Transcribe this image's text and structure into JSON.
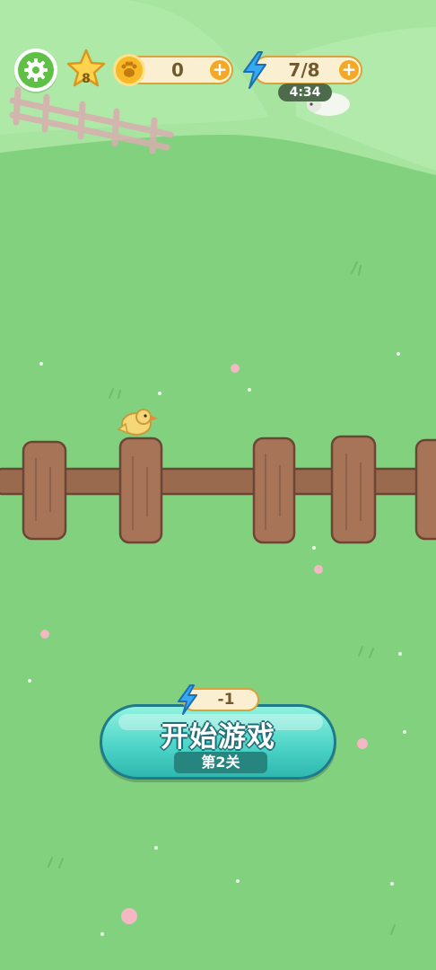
{
  "hud": {
    "star_level": "8",
    "coins": "0",
    "energy": "7/8",
    "energy_timer": "4:34"
  },
  "start": {
    "cost": "-1",
    "button_label": "开始游戏",
    "level_label": "第2关"
  },
  "icons": {
    "settings": "gear-icon",
    "star": "star-icon",
    "coin": "paw-coin-icon",
    "energy": "lightning-icon",
    "add": "plus-icon"
  },
  "colors": {
    "grass": "#82d17f",
    "hill": "#a8e6a2",
    "fence": "#9a6a4e",
    "button": "#4fd5c8",
    "accent": "#f4a827"
  }
}
